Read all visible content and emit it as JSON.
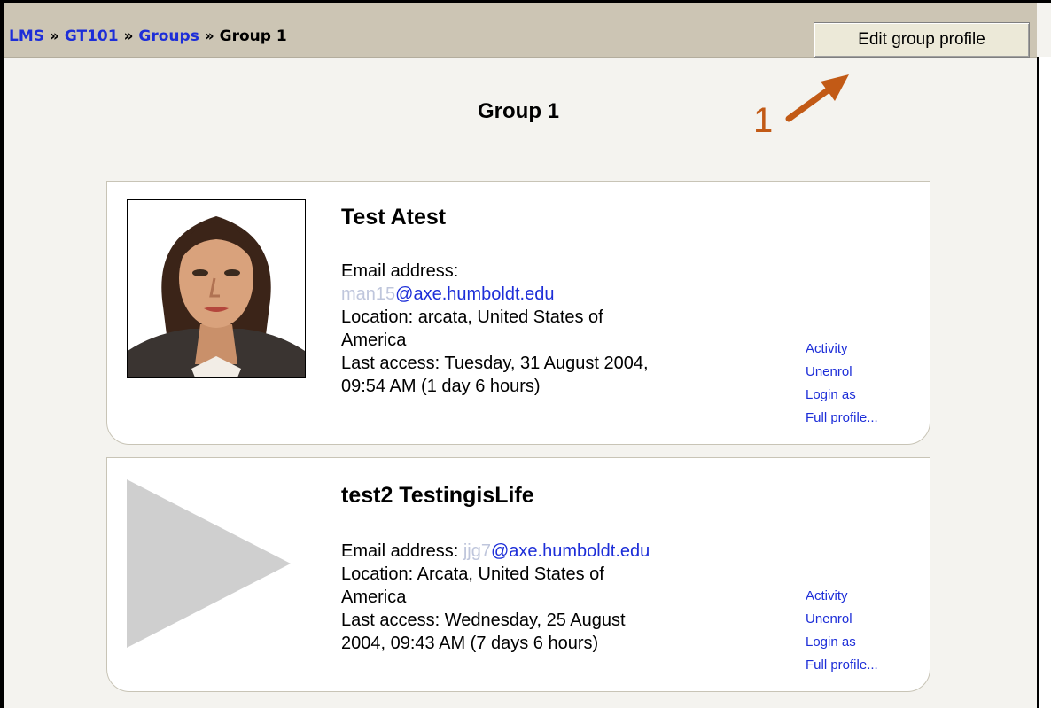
{
  "nav": {
    "crumbs": [
      "LMS",
      "GT101",
      "Groups"
    ],
    "separator": "»",
    "current": "Group 1",
    "edit_button": "Edit group profile"
  },
  "page_title": "Group 1",
  "annotation": {
    "number": "1",
    "color": "#c25a16"
  },
  "users": [
    {
      "name": "Test Atest",
      "email_label": "Email address:",
      "email_user": "man15",
      "email_domain": "@axe.humboldt.edu",
      "location_1": "Location: arcata, United States of",
      "location_2": "America",
      "last_access_1": "Last access: Tuesday, 31 August 2004,",
      "last_access_2": "09:54 AM  (1 day 6 hours)",
      "avatar": "user-photo",
      "links": [
        "Activity",
        "Unenrol",
        "Login as",
        "Full profile..."
      ]
    },
    {
      "name": "test2 TestingisLife",
      "email_label": "Email address:",
      "email_user": "jjg7",
      "email_domain": "@axe.humboldt.edu",
      "location_1": "Location: Arcata, United States of",
      "location_2": "America",
      "last_access_1": "Last access: Wednesday, 25 August",
      "last_access_2": "2004, 09:43 AM  (7 days 6 hours)",
      "avatar": "default-avatar-triangle",
      "links": [
        "Activity",
        "Unenrol",
        "Login as",
        "Full profile..."
      ]
    }
  ],
  "colors": {
    "link": "#1d2ed8",
    "navbar": "#ccc5b4",
    "background": "#f4f3ef"
  }
}
